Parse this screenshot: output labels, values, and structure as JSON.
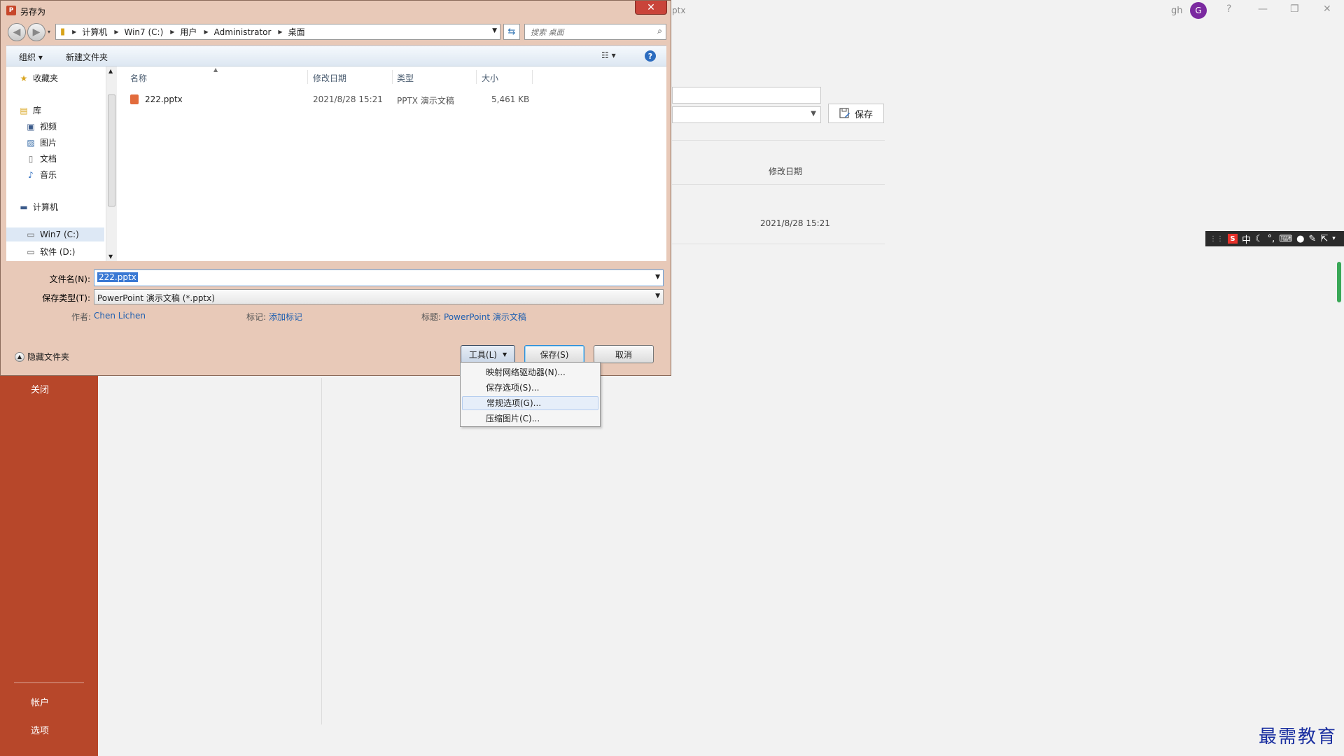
{
  "ppt": {
    "doc_name_fragment": "ptx",
    "user_initials": "gh",
    "avatar_letter": "G",
    "window_controls": [
      "?",
      "—",
      "❐",
      "✕"
    ],
    "nav_close": "关闭",
    "nav_account": "帐户",
    "nav_options": "选项",
    "save_button": "保存",
    "column_modified": "修改日期",
    "row_modified": "2021/8/28 15:21",
    "accent_color": "#b7472a"
  },
  "ime": {
    "logo": "S",
    "mode": "中"
  },
  "watermark": "最需教育",
  "dialog": {
    "title": "另存为",
    "breadcrumbs": [
      "计算机",
      "Win7 (C:)",
      "用户",
      "Administrator",
      "桌面"
    ],
    "search_placeholder": "搜索 桌面",
    "toolbar": {
      "organize": "组织 ▾",
      "new_folder": "新建文件夹"
    },
    "nav": {
      "favorites": "收藏夹",
      "libraries": "库",
      "videos": "视频",
      "pictures": "图片",
      "documents": "文档",
      "music": "音乐",
      "computer": "计算机",
      "drive_c": "Win7 (C:)",
      "drive_d": "软件 (D:)"
    },
    "columns": {
      "name": "名称",
      "modified": "修改日期",
      "type": "类型",
      "size": "大小"
    },
    "files": [
      {
        "name": "222.pptx",
        "modified": "2021/8/28 15:21",
        "type": "PPTX 演示文稿",
        "size": "5,461 KB"
      }
    ],
    "filename_label": "文件名(N):",
    "filename_value": "222.pptx",
    "filetype_label": "保存类型(T):",
    "filetype_value": "PowerPoint 演示文稿 (*.pptx)",
    "meta": {
      "author_label": "作者:",
      "author_value": "Chen Lichen",
      "tags_label": "标记:",
      "tags_value": "添加标记",
      "title_label": "标题:",
      "title_value": "PowerPoint 演示文稿"
    },
    "hide_folders": "隐藏文件夹",
    "buttons": {
      "tools": "工具(L)",
      "save": "保存(S)",
      "cancel": "取消"
    },
    "tools_menu": [
      "映射网络驱动器(N)...",
      "保存选项(S)...",
      "常规选项(G)...",
      "压缩图片(C)..."
    ]
  }
}
